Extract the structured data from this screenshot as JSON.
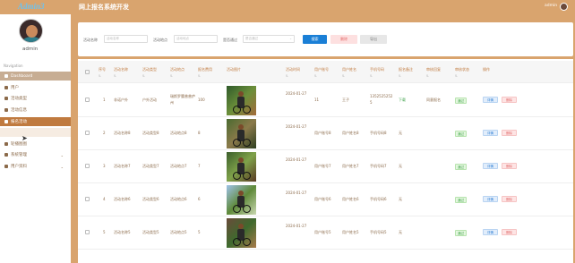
{
  "header": {
    "logo": "Admin3",
    "title": "网上报名系统开发",
    "user": "admin"
  },
  "sidebar": {
    "username": "admin",
    "nav_caption": "Navigation",
    "items": [
      {
        "label": "Dashboard",
        "icon": "dashboard-icon"
      },
      {
        "label": "用户",
        "icon": "user-icon"
      },
      {
        "label": "活动类型",
        "icon": "category-icon"
      },
      {
        "label": "活动信息",
        "icon": "info-icon"
      },
      {
        "label": "报名活动",
        "icon": "signup-icon"
      },
      {
        "label": "",
        "icon": ""
      },
      {
        "label": "轮播图图",
        "icon": "image-icon"
      },
      {
        "label": "系统管理",
        "icon": "settings-icon"
      },
      {
        "label": "用户资料",
        "icon": "profile-icon"
      }
    ]
  },
  "search": {
    "name_label": "活动名称",
    "name_placeholder": "活动名称",
    "place_label": "活动地点",
    "place_placeholder": "活动地点",
    "pass_label": "是否通过",
    "pass_placeholder": "是否通过",
    "search_btn": "搜索",
    "delete_btn": "删除",
    "export_btn": "导出"
  },
  "table": {
    "columns": [
      "序号",
      "活动名称",
      "活动类型",
      "活动地点",
      "报名费用",
      "活动图片",
      "活动时间",
      "用户账号",
      "用户姓名",
      "手机号码",
      "报名备注",
      "审核回复",
      "审核状态",
      "操作"
    ],
    "sort_marker": "⇅",
    "rows": [
      {
        "no": "1",
        "name": "非诺户外",
        "type": "户外活动",
        "place": "瑞斯罗腰普普庐州",
        "fee": "100",
        "time": "2024-01-27",
        "account": "11",
        "username": "王子",
        "phone": "13525252525",
        "note": "下载",
        "reply": "同意报名",
        "status": "通过"
      },
      {
        "no": "2",
        "name": "活动名称8",
        "type": "活动类型8",
        "place": "活动地点8",
        "fee": "8",
        "time": "2024-01-27",
        "account": "用户账号8",
        "username": "用户姓名8",
        "phone": "手机号码8",
        "note": "无",
        "reply": "",
        "status": "通过"
      },
      {
        "no": "3",
        "name": "活动名称7",
        "type": "活动类型7",
        "place": "活动地点7",
        "fee": "7",
        "time": "2024-01-27",
        "account": "用户账号7",
        "username": "用户姓名7",
        "phone": "手机号码7",
        "note": "无",
        "reply": "",
        "status": "通过"
      },
      {
        "no": "4",
        "name": "活动名称6",
        "type": "活动类型6",
        "place": "活动地点6",
        "fee": "6",
        "time": "2024-01-27",
        "account": "用户账号6",
        "username": "用户姓名6",
        "phone": "手机号码6",
        "note": "无",
        "reply": "",
        "status": "通过"
      },
      {
        "no": "5",
        "name": "活动名称5",
        "type": "活动类型5",
        "place": "活动地点5",
        "fee": "5",
        "time": "2024-01-27",
        "account": "用户账号5",
        "username": "用户姓名5",
        "phone": "手机号码5",
        "note": "无",
        "reply": "",
        "status": "通过"
      }
    ],
    "op_detail": "详情",
    "op_delete": "删除"
  },
  "colors": {
    "header": "#d9a46e",
    "accent": "#c07a3f",
    "primary_button": "#1a7fd6"
  }
}
